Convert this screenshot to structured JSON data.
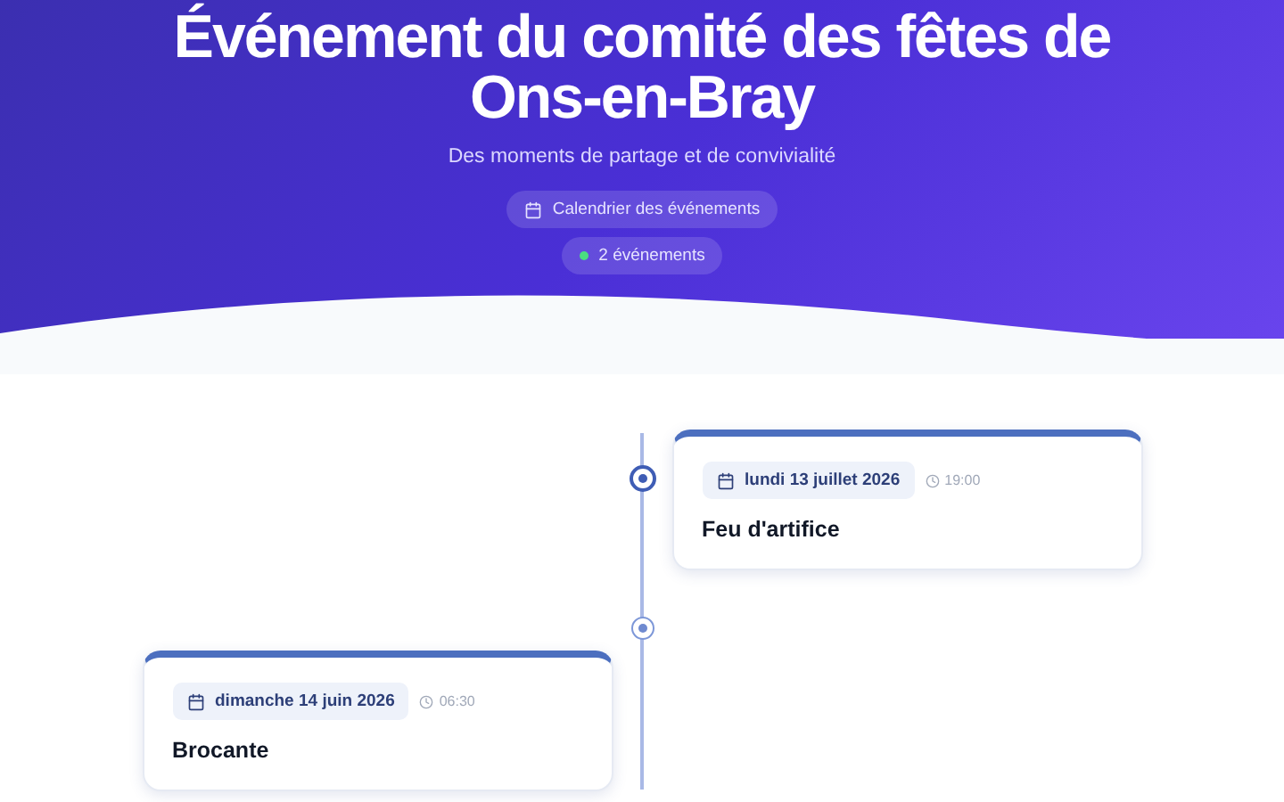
{
  "header": {
    "title_lines": [
      "Événement du comité des fêtes de",
      "Ons-en-Bray"
    ],
    "subtitle": "Des moments de partage et de convivialité",
    "calendar_link": "Calendrier des événements",
    "count_badge": "2 événements"
  },
  "events": [
    {
      "date": "lundi 13 juillet 2026",
      "time": "19:00",
      "title": "Feu d'artifice",
      "active": true
    },
    {
      "date": "dimanche 14 juin 2026",
      "time": "06:30",
      "title": "Brocante",
      "active": false
    }
  ]
}
